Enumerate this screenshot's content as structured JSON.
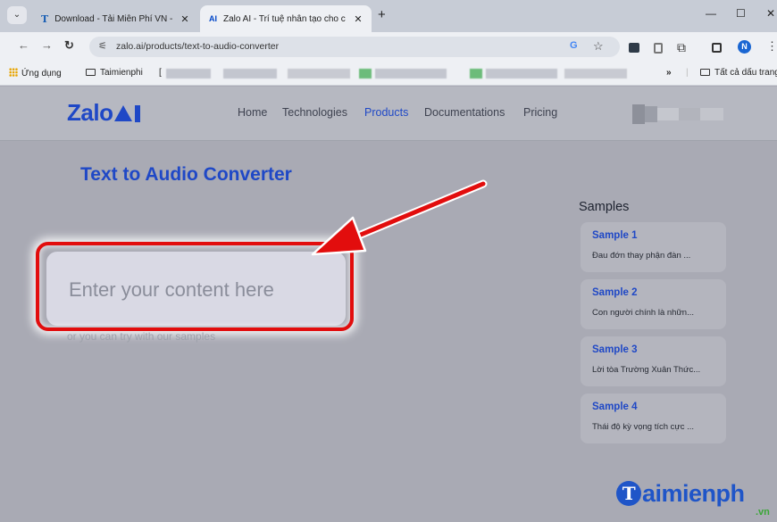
{
  "browser": {
    "tabs": [
      {
        "label": "Download - Tải Miễn Phí VN -",
        "favicon": "T",
        "active": false
      },
      {
        "label": "Zalo AI - Trí tuệ nhân tạo cho c",
        "favicon": "AI",
        "active": true
      }
    ],
    "new_tab_label": "+",
    "url": "zalo.ai/products/text-to-audio-converter",
    "profile_initial": "N",
    "bookmarks": {
      "apps": "Ứng dụng",
      "folder": "Taimienphi",
      "more": "»",
      "all_bookmarks": "Tất cả dấu trang"
    }
  },
  "site": {
    "logo_text": "Zalo",
    "nav": [
      {
        "label": "Home",
        "active": false
      },
      {
        "label": "Technologies",
        "active": false
      },
      {
        "label": "Products",
        "active": true
      },
      {
        "label": "Documentations",
        "active": false
      },
      {
        "label": "Pricing",
        "active": false
      }
    ]
  },
  "page": {
    "title": "Text to Audio Converter",
    "editor_placeholder": "Enter your content here",
    "hint": "or you can try with our samples",
    "samples_title": "Samples",
    "samples": [
      {
        "name": "Sample 1",
        "desc": "Đau đớn thay phận đàn ..."
      },
      {
        "name": "Sample 2",
        "desc": "Con người chính là nhữn..."
      },
      {
        "name": "Sample 3",
        "desc": "Lời tòa Trường Xuân Thức..."
      },
      {
        "name": "Sample 4",
        "desc": "Thái độ kỳ vọng tích cực ..."
      }
    ]
  },
  "watermark": {
    "text": "aimienph",
    "initial": "T",
    "suffix": ".vn"
  },
  "colors": {
    "accent": "#1f48c6",
    "highlight": "#e20d0d"
  }
}
